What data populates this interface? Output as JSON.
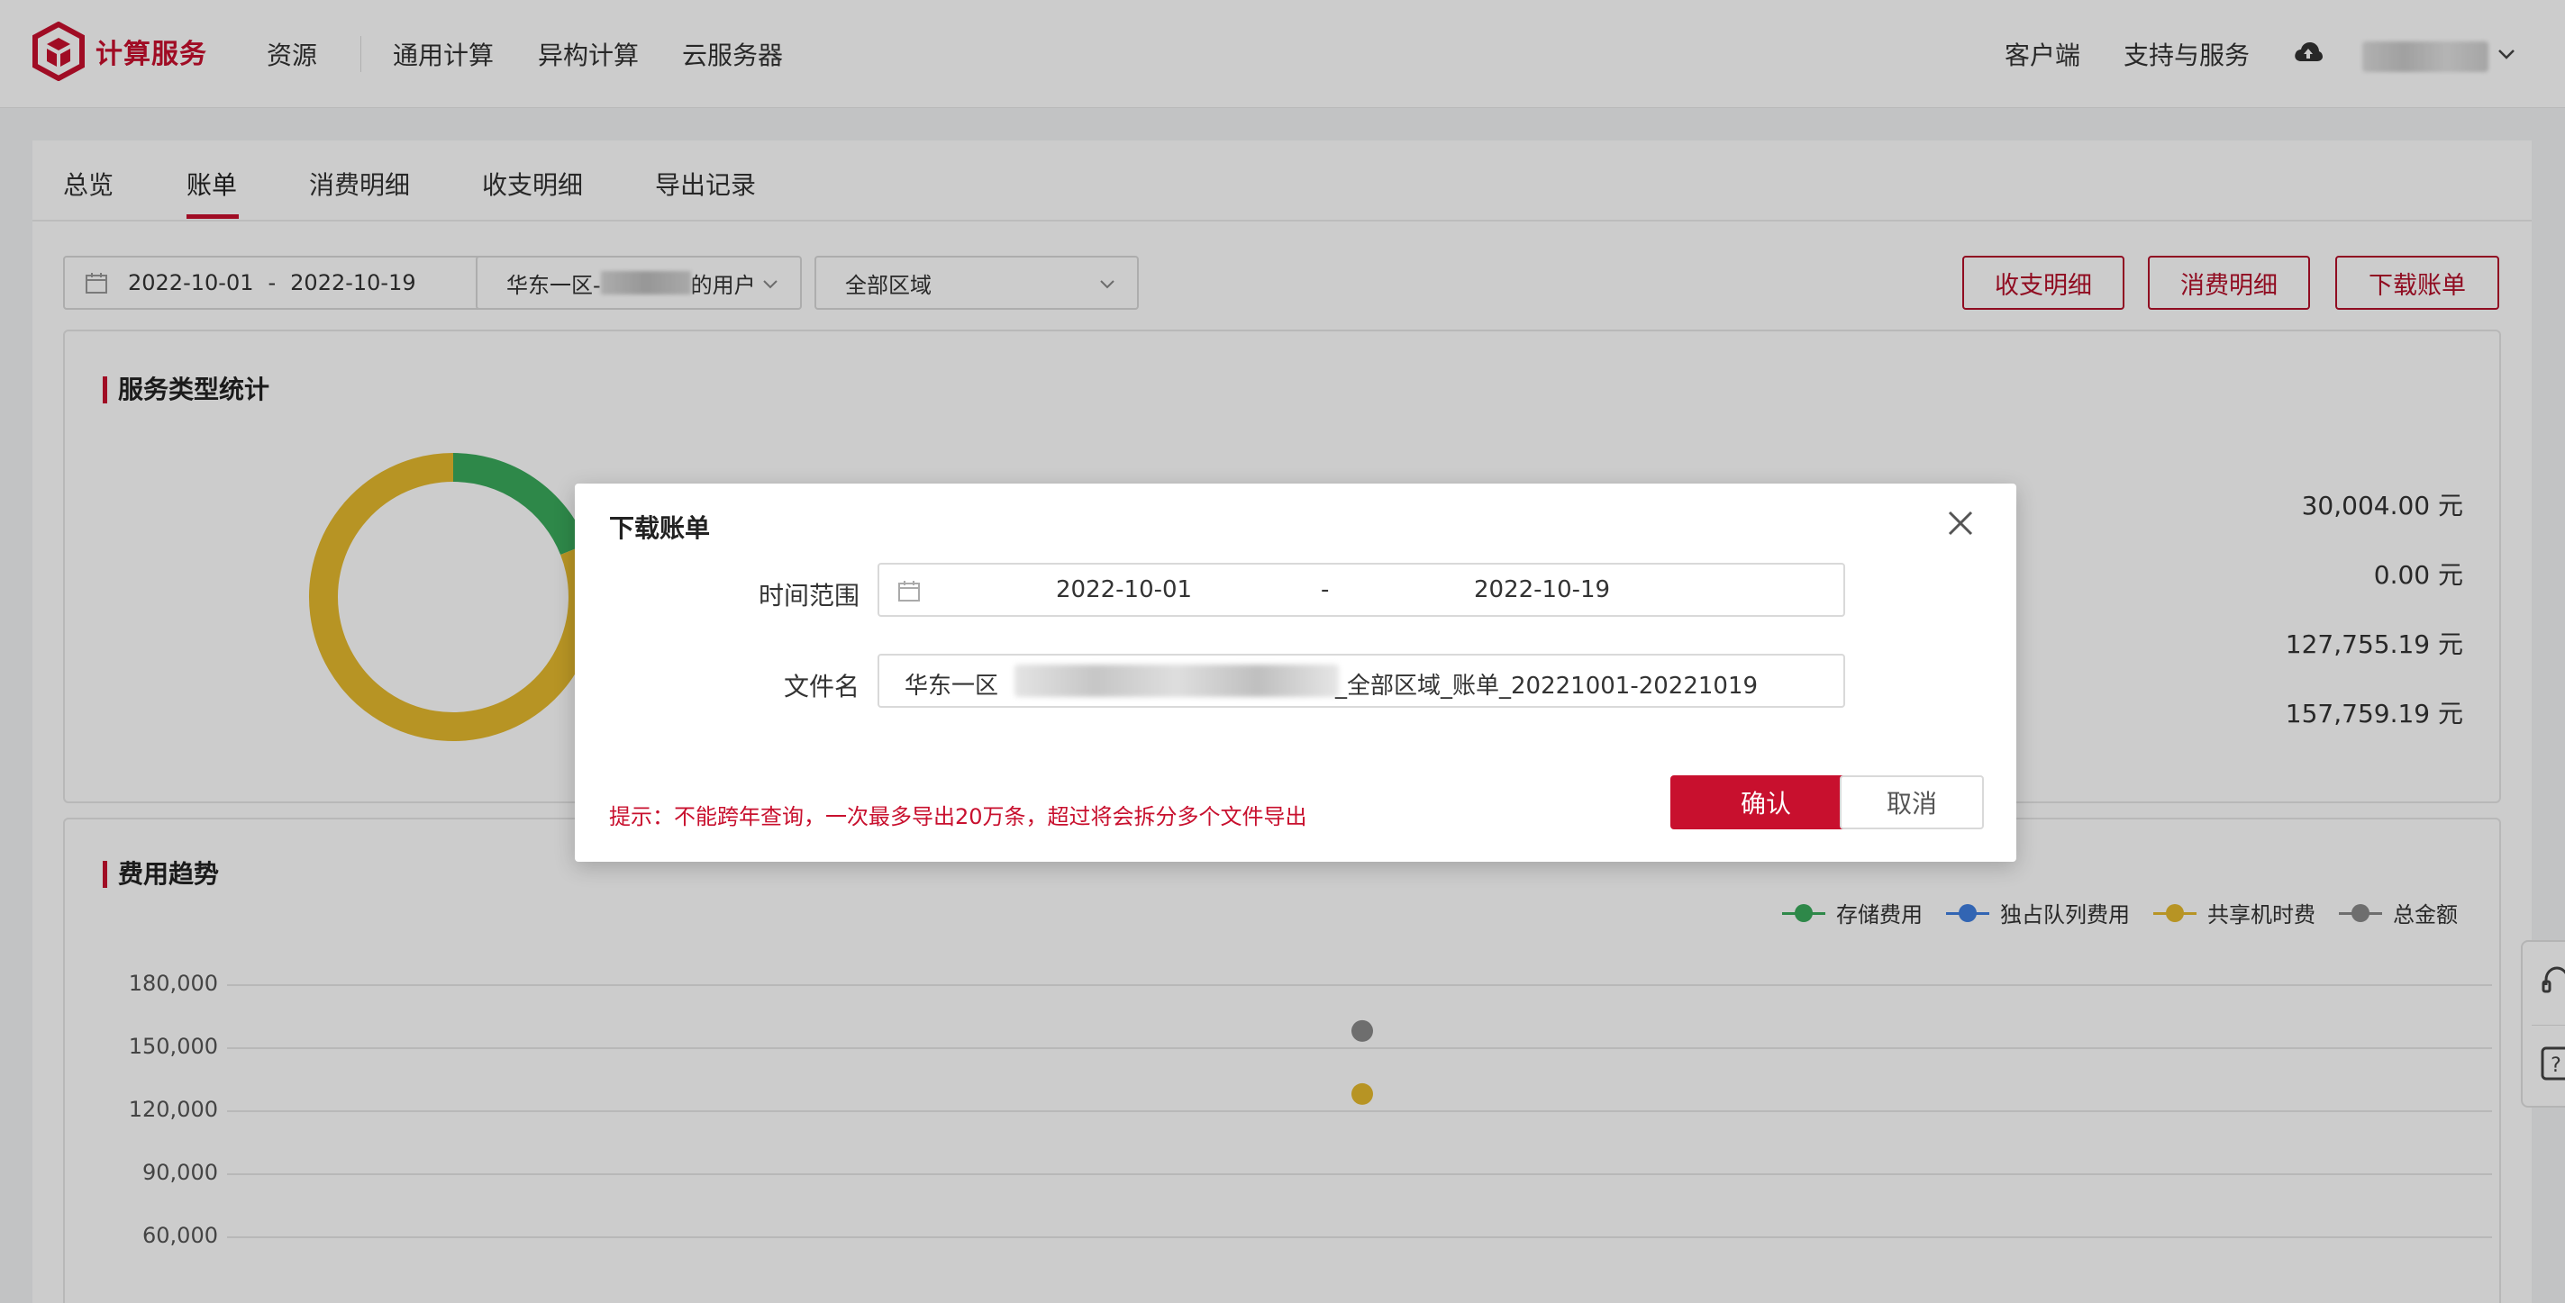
{
  "header": {
    "brand": "计算服务",
    "nav": [
      "资源",
      "通用计算",
      "异构计算",
      "云服务器"
    ],
    "right": [
      "客户端",
      "支持与服务"
    ]
  },
  "tabs": [
    "总览",
    "账单",
    "消费明细",
    "收支明细",
    "导出记录"
  ],
  "active_tab": "账单",
  "filters": {
    "date_start": "2022-10-01",
    "date_sep": "-",
    "date_end": "2022-10-19",
    "account_prefix": "华东一区-",
    "account_suffix": "的用户",
    "region": "全部区域"
  },
  "actions": {
    "income_detail": "收支明细",
    "consume_detail": "消费明细",
    "download_bill": "下载账单"
  },
  "service_stats": {
    "title": "服务类型统计",
    "amounts": [
      "30,004.00 元",
      "0.00 元",
      "127,755.19 元",
      "157,759.19 元"
    ],
    "donut": [
      {
        "name": "存储费用",
        "value": 30004.0,
        "color": "#3aaa5c"
      },
      {
        "name": "共享机时费",
        "value": 127755.19,
        "color": "#e5b92e"
      }
    ]
  },
  "trend": {
    "title": "费用趋势",
    "legend": [
      {
        "name": "存储费用",
        "color": "#3aaa5c"
      },
      {
        "name": "独占队列费用",
        "color": "#3f7fe0"
      },
      {
        "name": "共享机时费",
        "color": "#e5b92e"
      },
      {
        "name": "总金额",
        "color": "#8a8a8a"
      }
    ],
    "y_ticks": [
      "180,000",
      "150,000",
      "120,000",
      "90,000",
      "60,000"
    ]
  },
  "chart_data": {
    "type": "scatter",
    "title": "费用趋势",
    "ylim": [
      60000,
      180000
    ],
    "series": [
      {
        "name": "共享机时费",
        "values": [
          127755.19
        ]
      },
      {
        "name": "总金额",
        "values": [
          157759.19
        ]
      }
    ]
  },
  "modal": {
    "title": "下载账单",
    "time_label": "时间范围",
    "range_start": "2022-10-01",
    "range_sep": "-",
    "range_end": "2022-10-19",
    "filename_label": "文件名",
    "filename_prefix": "华东一区",
    "filename_suffix": "_全部区域_账单_20221001-20221019",
    "hint": "提示：不能跨年查询，一次最多导出20万条，超过将会拆分多个文件导出",
    "confirm": "确认",
    "cancel": "取消"
  }
}
